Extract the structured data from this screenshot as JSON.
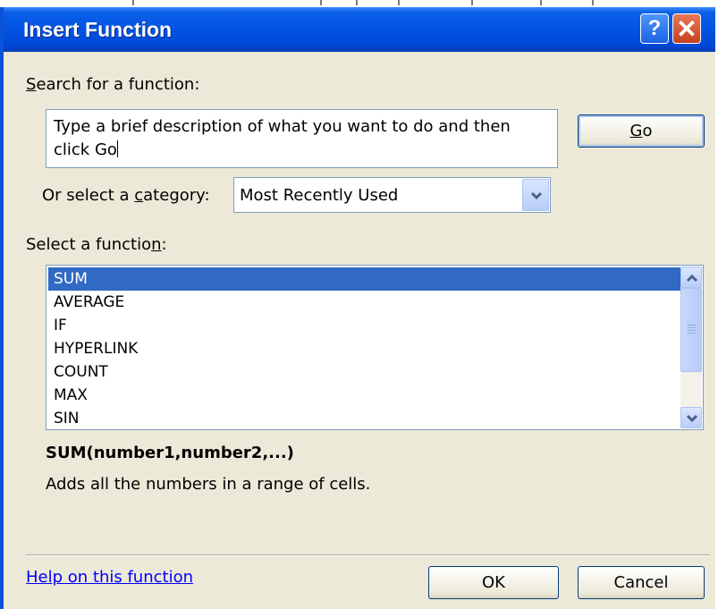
{
  "dialog": {
    "title": "Insert Function",
    "help_glyph": "?",
    "close_glyph": "✕"
  },
  "search": {
    "label": "Search for a function:",
    "text": "Type a brief description of what you want to do and then click Go",
    "go_button": "Go"
  },
  "category": {
    "label": "Or select a category:",
    "selected": "Most Recently Used"
  },
  "functions": {
    "label": "Select a function:",
    "items": [
      "SUM",
      "AVERAGE",
      "IF",
      "HYPERLINK",
      "COUNT",
      "MAX",
      "SIN"
    ],
    "selected": "SUM"
  },
  "details": {
    "syntax": "SUM(number1,number2,...)",
    "description": "Adds all the numbers in a range of cells."
  },
  "footer": {
    "help_link": "Help on this function",
    "ok_button": "OK",
    "cancel_button": "Cancel"
  },
  "colors": {
    "titlebar": "#0354e3",
    "selection": "#316ac5",
    "dialog_bg": "#ece9d8",
    "link": "#0000ff"
  },
  "icons": [
    "help-icon",
    "close-icon",
    "dropdown-arrow-icon",
    "scroll-up-icon",
    "scroll-down-icon"
  ]
}
